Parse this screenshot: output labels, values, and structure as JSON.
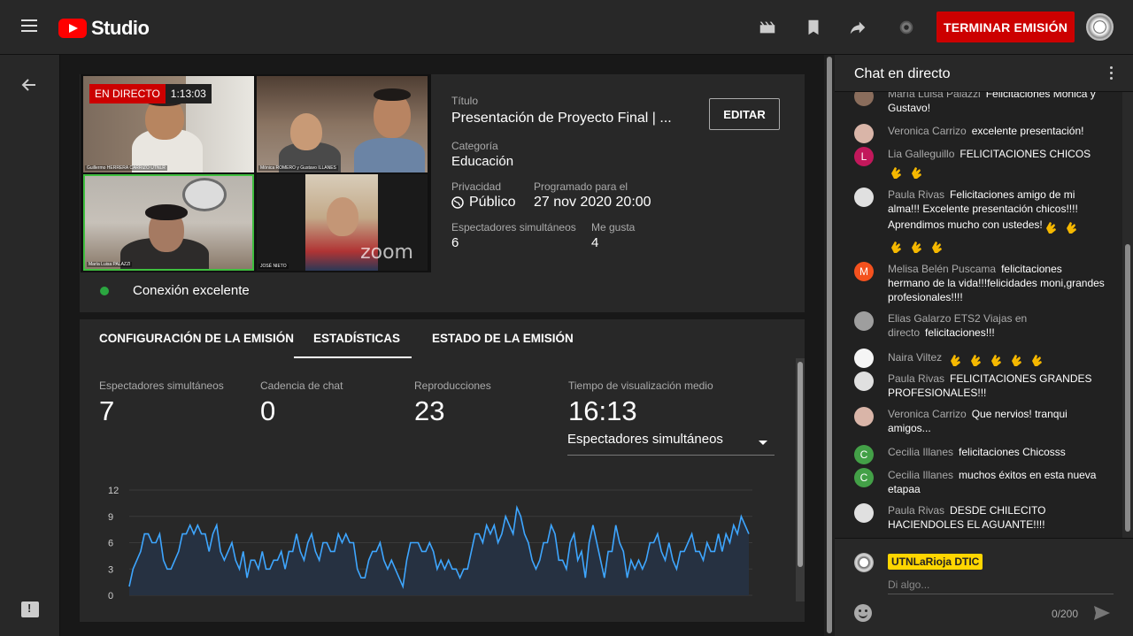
{
  "app": {
    "logo_text": "Studio",
    "end_button": "TERMINAR EMISIÓN"
  },
  "video": {
    "live_label": "EN DIRECTO",
    "time": "1:13:03",
    "tile_names": [
      "Guillermo HERRERA CARRIZO UTNLR",
      "Mónica ROMERO y Gustavo ILLANES",
      "María Luisa PALAZZI",
      "JOSÉ NIETO"
    ],
    "zoom_text": "zoom"
  },
  "connection": "Conexión excelente",
  "details": {
    "title_label": "Título",
    "title": "Presentación de Proyecto Final | ...",
    "edit_button": "EDITAR",
    "category_label": "Categoría",
    "category": "Educación",
    "privacy_label": "Privacidad",
    "privacy": "Público",
    "scheduled_label": "Programado para el",
    "scheduled": "27 nov 2020 20:00",
    "viewers_label": "Espectadores simultáneos",
    "viewers": "6",
    "likes_label": "Me gusta",
    "likes": "4"
  },
  "tabs": [
    "CONFIGURACIÓN DE LA EMISIÓN",
    "ESTADÍSTICAS",
    "ESTADO DE LA EMISIÓN"
  ],
  "stats": [
    {
      "label": "Espectadores simultáneos",
      "value": "7"
    },
    {
      "label": "Cadencia de chat",
      "value": "0"
    },
    {
      "label": "Reproducciones",
      "value": "23"
    },
    {
      "label": "Tiempo de visualización medio",
      "value": "16:13"
    }
  ],
  "metric_select": "Espectadores simultáneos",
  "chart_data": {
    "type": "area",
    "ylim": [
      0,
      12
    ],
    "yticks": [
      "12",
      "9",
      "6",
      "3",
      "0"
    ],
    "values": [
      1,
      3,
      4,
      5,
      7,
      7,
      6,
      6,
      7,
      4,
      3,
      3,
      4,
      5,
      7,
      7,
      8,
      7,
      8,
      7,
      7,
      5,
      7,
      8,
      5,
      4,
      5,
      6,
      4,
      3,
      5,
      2,
      4,
      4,
      3,
      5,
      3,
      3,
      4,
      4,
      5,
      3,
      5,
      5,
      7,
      5,
      4,
      6,
      7,
      5,
      4,
      6,
      6,
      5,
      5,
      7,
      6,
      7,
      6,
      6,
      3,
      2,
      2,
      4,
      5,
      5,
      6,
      4,
      3,
      4,
      3,
      2,
      1,
      4,
      6,
      6,
      6,
      5,
      5,
      6,
      5,
      3,
      4,
      3,
      4,
      3,
      3,
      2,
      3,
      3,
      5,
      7,
      7,
      6,
      8,
      7,
      8,
      6,
      7,
      9,
      8,
      7,
      10,
      9,
      7,
      6,
      4,
      3,
      4,
      6,
      6,
      8,
      7,
      4,
      4,
      3,
      6,
      7,
      4,
      5,
      2,
      6,
      8,
      6,
      4,
      2,
      5,
      5,
      8,
      6,
      5,
      2,
      4,
      3,
      4,
      3,
      4,
      6,
      6,
      7,
      5,
      4,
      6,
      4,
      3,
      5,
      5,
      6,
      7,
      5,
      5,
      4,
      6,
      5,
      5,
      7,
      5,
      7,
      6,
      8,
      7,
      9,
      8,
      7
    ],
    "series_color": "#3ea6ff"
  },
  "chat": {
    "header": "Chat en directo",
    "messages": [
      {
        "author": "María Luisa Palazzi",
        "text": "Felicitaciones Mónica y Gustavo!",
        "avatar_color": "#8a6d5c",
        "initial": ""
      },
      {
        "author": "Veronica Carrizo",
        "text": "excelente presentación!",
        "avatar_color": "#d9b5a8",
        "initial": ""
      },
      {
        "author": "Lia Galleguillo",
        "text": "FELICITACIONES CHICOS",
        "avatar_color": "#c2185b",
        "initial": "L"
      },
      {
        "author": "Paula Rivas",
        "text": "Felicitaciones amigo de mi alma!!! Excelente presentación chicos!!!! Aprendimos mucho con ustedes!",
        "avatar_color": "#e0e0e0",
        "initial": ""
      },
      {
        "author": "Melisa Belén Puscama",
        "text": "felicitaciones hermano de la vida!!!felicidades moni,grandes profesionales!!!!",
        "avatar_color": "#f4511e",
        "initial": "M"
      },
      {
        "author": "Elias Galarzo ETS2 Viajas en directo",
        "text": "felicitaciones!!!",
        "avatar_color": "#9e9e9e",
        "initial": ""
      },
      {
        "author": "Naira Viltez",
        "text": "",
        "avatar_color": "#f5f5f5",
        "initial": ""
      },
      {
        "author": "Paula Rivas",
        "text": "FELICITACIONES GRANDES PROFESIONALES!!!",
        "avatar_color": "#e0e0e0",
        "initial": ""
      },
      {
        "author": "Veronica Carrizo",
        "text": "Que nervios! tranqui amigos...",
        "avatar_color": "#d9b5a8",
        "initial": ""
      },
      {
        "author": "Cecilia Illanes",
        "text": "felicitaciones Chicosss",
        "avatar_color": "#43a047",
        "initial": "C"
      },
      {
        "author": "Cecilia Illanes",
        "text": "muchos éxitos en esta nueva etapaa",
        "avatar_color": "#43a047",
        "initial": "C"
      },
      {
        "author": "Paula Rivas",
        "text": "DESDE CHILECITO HACIENDOLES EL AGUANTE!!!!",
        "avatar_color": "#e0e0e0",
        "initial": ""
      }
    ],
    "my_name": "UTNLaRioja DTIC",
    "input_placeholder": "Di algo...",
    "counter": "0/200"
  }
}
